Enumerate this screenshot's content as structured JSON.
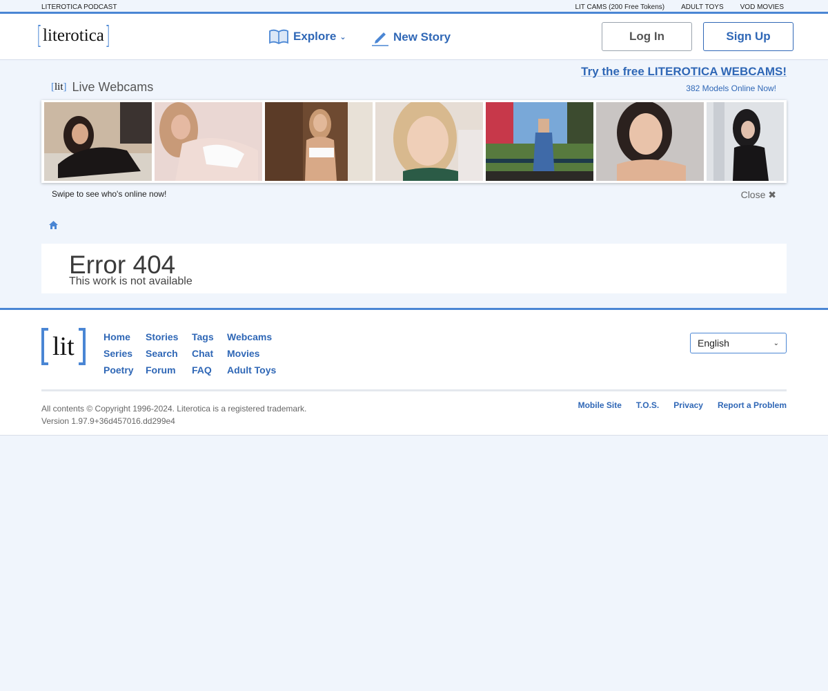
{
  "topstrip": {
    "left_link": "LITEROTICA PODCAST",
    "right_links": [
      "LIT CAMS (200 Free Tokens)",
      "ADULT TOYS",
      "VOD MOVIES"
    ]
  },
  "header": {
    "logo_text": "literotica",
    "explore_label": "Explore",
    "new_story_label": "New Story",
    "login_label": "Log In",
    "signup_label": "Sign Up"
  },
  "webcams": {
    "brand": "lit",
    "title": "Live Webcams",
    "promo": "Try the free LITEROTICA WEBCAMS!",
    "count": "382 Models Online Now!",
    "swipe_text": "Swipe to see who's online now!",
    "close_label": "Close",
    "thumbnails": 7
  },
  "error": {
    "title": "Error 404",
    "subtitle": "This work is not available"
  },
  "footer": {
    "logo_text": "lit",
    "links": [
      "Home",
      "Stories",
      "Tags",
      "Webcams",
      "Series",
      "Search",
      "Chat",
      "Movies",
      "Poetry",
      "Forum",
      "FAQ",
      "Adult Toys"
    ],
    "language": "English",
    "copyright": "All contents © Copyright 1996-2024. Literotica is a registered trademark.",
    "version": "Version 1.97.9+36d457016.dd299e4",
    "legal_links": [
      "Mobile Site",
      "T.O.S.",
      "Privacy",
      "Report a Problem"
    ]
  },
  "colors": {
    "accent": "#4a86d4",
    "link": "#2f67b6",
    "background": "#f0f5fc"
  }
}
